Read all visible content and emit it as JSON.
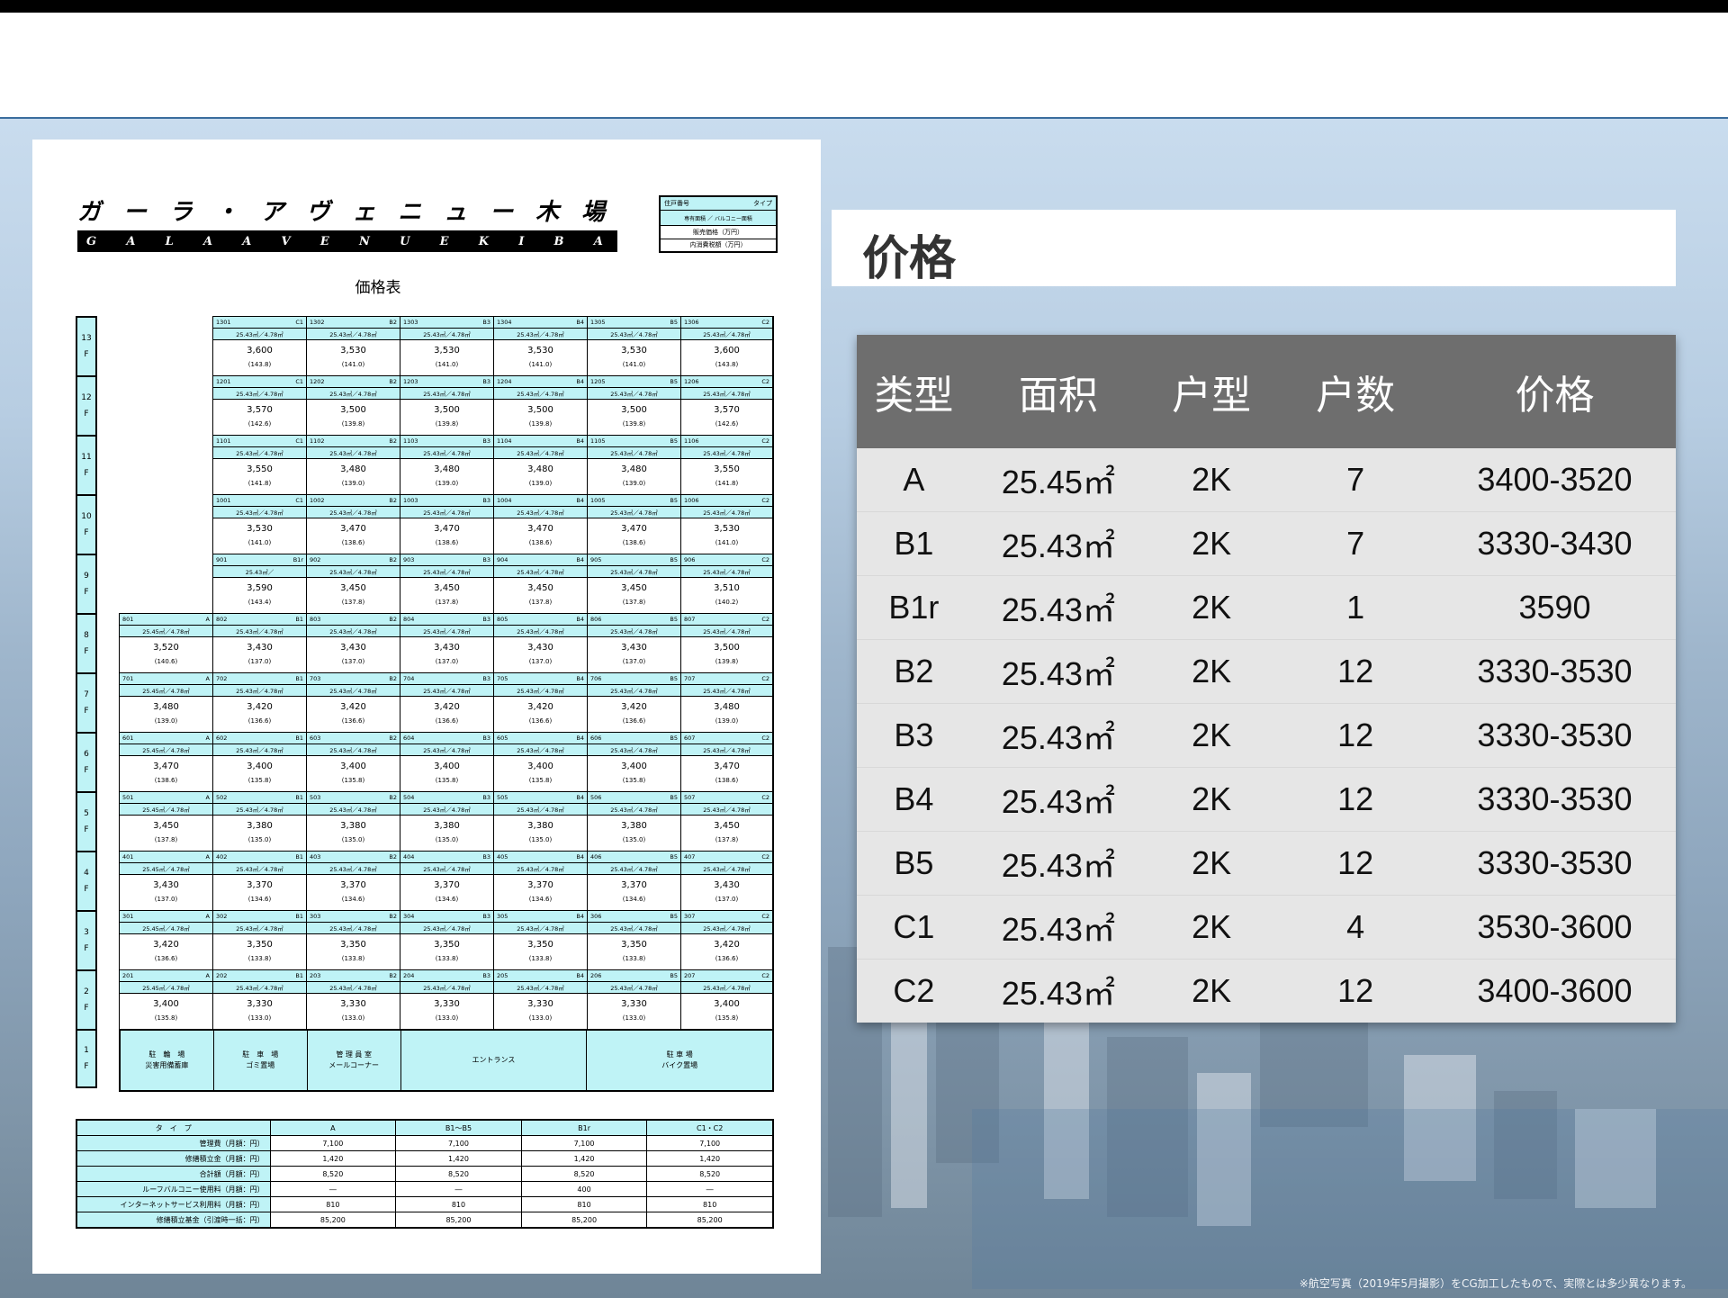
{
  "document": {
    "brand_jp": [
      "ガ",
      "ー",
      "ラ",
      "・",
      "ア",
      "ヴ",
      "ェ",
      "ニ",
      "ュ",
      "ー",
      "木",
      "場"
    ],
    "brand_en": [
      "G",
      "A",
      "L",
      "A",
      "A",
      "V",
      "E",
      "N",
      "U",
      "E",
      "K",
      "I",
      "B",
      "A"
    ],
    "legend": {
      "l1a": "住戸番号",
      "l1b": "タイプ",
      "l2": "専有面積 ／ バルコニー面積",
      "l3": "販売価格（万円）",
      "l4": "内消費税額（万円）"
    },
    "title": "価格表",
    "floors": [
      "13\nF",
      "12\nF",
      "11\nF",
      "10\nF",
      "9\nF",
      "8\nF",
      "7\nF",
      "6\nF",
      "5\nF",
      "4\nF",
      "3\nF",
      "2\nF",
      "1\nF"
    ],
    "rows": [
      {
        "units": [
          null,
          {
            "no": "1301",
            "type": "C1",
            "area": "25.43㎡／4.78㎡",
            "price": "3,600",
            "tax": "(143.8)"
          },
          {
            "no": "1302",
            "type": "B2",
            "area": "25.43㎡／4.78㎡",
            "price": "3,530",
            "tax": "(141.0)"
          },
          {
            "no": "1303",
            "type": "B3",
            "area": "25.43㎡／4.78㎡",
            "price": "3,530",
            "tax": "(141.0)"
          },
          {
            "no": "1304",
            "type": "B4",
            "area": "25.43㎡／4.78㎡",
            "price": "3,530",
            "tax": "(141.0)"
          },
          {
            "no": "1305",
            "type": "B5",
            "area": "25.43㎡／4.78㎡",
            "price": "3,530",
            "tax": "(141.0)"
          },
          {
            "no": "1306",
            "type": "C2",
            "area": "25.43㎡／4.78㎡",
            "price": "3,600",
            "tax": "(143.8)"
          }
        ]
      },
      {
        "units": [
          null,
          {
            "no": "1201",
            "type": "C1",
            "area": "25.43㎡／4.78㎡",
            "price": "3,570",
            "tax": "(142.6)"
          },
          {
            "no": "1202",
            "type": "B2",
            "area": "25.43㎡／4.78㎡",
            "price": "3,500",
            "tax": "(139.8)"
          },
          {
            "no": "1203",
            "type": "B3",
            "area": "25.43㎡／4.78㎡",
            "price": "3,500",
            "tax": "(139.8)"
          },
          {
            "no": "1204",
            "type": "B4",
            "area": "25.43㎡／4.78㎡",
            "price": "3,500",
            "tax": "(139.8)"
          },
          {
            "no": "1205",
            "type": "B5",
            "area": "25.43㎡／4.78㎡",
            "price": "3,500",
            "tax": "(139.8)"
          },
          {
            "no": "1206",
            "type": "C2",
            "area": "25.43㎡／4.78㎡",
            "price": "3,570",
            "tax": "(142.6)"
          }
        ]
      },
      {
        "units": [
          null,
          {
            "no": "1101",
            "type": "C1",
            "area": "25.43㎡／4.78㎡",
            "price": "3,550",
            "tax": "(141.8)"
          },
          {
            "no": "1102",
            "type": "B2",
            "area": "25.43㎡／4.78㎡",
            "price": "3,480",
            "tax": "(139.0)"
          },
          {
            "no": "1103",
            "type": "B3",
            "area": "25.43㎡／4.78㎡",
            "price": "3,480",
            "tax": "(139.0)"
          },
          {
            "no": "1104",
            "type": "B4",
            "area": "25.43㎡／4.78㎡",
            "price": "3,480",
            "tax": "(139.0)"
          },
          {
            "no": "1105",
            "type": "B5",
            "area": "25.43㎡／4.78㎡",
            "price": "3,480",
            "tax": "(139.0)"
          },
          {
            "no": "1106",
            "type": "C2",
            "area": "25.43㎡／4.78㎡",
            "price": "3,550",
            "tax": "(141.8)"
          }
        ]
      },
      {
        "units": [
          null,
          {
            "no": "1001",
            "type": "C1",
            "area": "25.43㎡／4.78㎡",
            "price": "3,530",
            "tax": "(141.0)"
          },
          {
            "no": "1002",
            "type": "B2",
            "area": "25.43㎡／4.78㎡",
            "price": "3,470",
            "tax": "(138.6)"
          },
          {
            "no": "1003",
            "type": "B3",
            "area": "25.43㎡／4.78㎡",
            "price": "3,470",
            "tax": "(138.6)"
          },
          {
            "no": "1004",
            "type": "B4",
            "area": "25.43㎡／4.78㎡",
            "price": "3,470",
            "tax": "(138.6)"
          },
          {
            "no": "1005",
            "type": "B5",
            "area": "25.43㎡／4.78㎡",
            "price": "3,470",
            "tax": "(138.6)"
          },
          {
            "no": "1006",
            "type": "C2",
            "area": "25.43㎡／4.78㎡",
            "price": "3,530",
            "tax": "(141.0)"
          }
        ]
      },
      {
        "units": [
          null,
          {
            "no": "901",
            "type": "B1r",
            "area": "25.43㎡／",
            "price": "3,590",
            "tax": "(143.4)"
          },
          {
            "no": "902",
            "type": "B2",
            "area": "25.43㎡／4.78㎡",
            "price": "3,450",
            "tax": "(137.8)"
          },
          {
            "no": "903",
            "type": "B3",
            "area": "25.43㎡／4.78㎡",
            "price": "3,450",
            "tax": "(137.8)"
          },
          {
            "no": "904",
            "type": "B4",
            "area": "25.43㎡／4.78㎡",
            "price": "3,450",
            "tax": "(137.8)"
          },
          {
            "no": "905",
            "type": "B5",
            "area": "25.43㎡／4.78㎡",
            "price": "3,450",
            "tax": "(137.8)"
          },
          {
            "no": "906",
            "type": "C2",
            "area": "25.43㎡／4.78㎡",
            "price": "3,510",
            "tax": "(140.2)"
          }
        ]
      },
      {
        "units": [
          {
            "no": "801",
            "type": "A",
            "area": "25.45㎡／4.78㎡",
            "price": "3,520",
            "tax": "(140.6)"
          },
          {
            "no": "802",
            "type": "B1",
            "area": "25.43㎡／4.78㎡",
            "price": "3,430",
            "tax": "(137.0)"
          },
          {
            "no": "803",
            "type": "B2",
            "area": "25.43㎡／4.78㎡",
            "price": "3,430",
            "tax": "(137.0)"
          },
          {
            "no": "804",
            "type": "B3",
            "area": "25.43㎡／4.78㎡",
            "price": "3,430",
            "tax": "(137.0)"
          },
          {
            "no": "805",
            "type": "B4",
            "area": "25.43㎡／4.78㎡",
            "price": "3,430",
            "tax": "(137.0)"
          },
          {
            "no": "806",
            "type": "B5",
            "area": "25.43㎡／4.78㎡",
            "price": "3,430",
            "tax": "(137.0)"
          },
          {
            "no": "807",
            "type": "C2",
            "area": "25.43㎡／4.78㎡",
            "price": "3,500",
            "tax": "(139.8)"
          }
        ]
      },
      {
        "units": [
          {
            "no": "701",
            "type": "A",
            "area": "25.45㎡／4.78㎡",
            "price": "3,480",
            "tax": "(139.0)"
          },
          {
            "no": "702",
            "type": "B1",
            "area": "25.43㎡／4.78㎡",
            "price": "3,420",
            "tax": "(136.6)"
          },
          {
            "no": "703",
            "type": "B2",
            "area": "25.43㎡／4.78㎡",
            "price": "3,420",
            "tax": "(136.6)"
          },
          {
            "no": "704",
            "type": "B3",
            "area": "25.43㎡／4.78㎡",
            "price": "3,420",
            "tax": "(136.6)"
          },
          {
            "no": "705",
            "type": "B4",
            "area": "25.43㎡／4.78㎡",
            "price": "3,420",
            "tax": "(136.6)"
          },
          {
            "no": "706",
            "type": "B5",
            "area": "25.43㎡／4.78㎡",
            "price": "3,420",
            "tax": "(136.6)"
          },
          {
            "no": "707",
            "type": "C2",
            "area": "25.43㎡／4.78㎡",
            "price": "3,480",
            "tax": "(139.0)"
          }
        ]
      },
      {
        "units": [
          {
            "no": "601",
            "type": "A",
            "area": "25.45㎡／4.78㎡",
            "price": "3,470",
            "tax": "(138.6)"
          },
          {
            "no": "602",
            "type": "B1",
            "area": "25.43㎡／4.78㎡",
            "price": "3,400",
            "tax": "(135.8)"
          },
          {
            "no": "603",
            "type": "B2",
            "area": "25.43㎡／4.78㎡",
            "price": "3,400",
            "tax": "(135.8)"
          },
          {
            "no": "604",
            "type": "B3",
            "area": "25.43㎡／4.78㎡",
            "price": "3,400",
            "tax": "(135.8)"
          },
          {
            "no": "605",
            "type": "B4",
            "area": "25.43㎡／4.78㎡",
            "price": "3,400",
            "tax": "(135.8)"
          },
          {
            "no": "606",
            "type": "B5",
            "area": "25.43㎡／4.78㎡",
            "price": "3,400",
            "tax": "(135.8)"
          },
          {
            "no": "607",
            "type": "C2",
            "area": "25.43㎡／4.78㎡",
            "price": "3,470",
            "tax": "(138.6)"
          }
        ]
      },
      {
        "units": [
          {
            "no": "501",
            "type": "A",
            "area": "25.45㎡／4.78㎡",
            "price": "3,450",
            "tax": "(137.8)"
          },
          {
            "no": "502",
            "type": "B1",
            "area": "25.43㎡／4.78㎡",
            "price": "3,380",
            "tax": "(135.0)"
          },
          {
            "no": "503",
            "type": "B2",
            "area": "25.43㎡／4.78㎡",
            "price": "3,380",
            "tax": "(135.0)"
          },
          {
            "no": "504",
            "type": "B3",
            "area": "25.43㎡／4.78㎡",
            "price": "3,380",
            "tax": "(135.0)"
          },
          {
            "no": "505",
            "type": "B4",
            "area": "25.43㎡／4.78㎡",
            "price": "3,380",
            "tax": "(135.0)"
          },
          {
            "no": "506",
            "type": "B5",
            "area": "25.43㎡／4.78㎡",
            "price": "3,380",
            "tax": "(135.0)"
          },
          {
            "no": "507",
            "type": "C2",
            "area": "25.43㎡／4.78㎡",
            "price": "3,450",
            "tax": "(137.8)"
          }
        ]
      },
      {
        "units": [
          {
            "no": "401",
            "type": "A",
            "area": "25.45㎡／4.78㎡",
            "price": "3,430",
            "tax": "(137.0)"
          },
          {
            "no": "402",
            "type": "B1",
            "area": "25.43㎡／4.78㎡",
            "price": "3,370",
            "tax": "(134.6)"
          },
          {
            "no": "403",
            "type": "B2",
            "area": "25.43㎡／4.78㎡",
            "price": "3,370",
            "tax": "(134.6)"
          },
          {
            "no": "404",
            "type": "B3",
            "area": "25.43㎡／4.78㎡",
            "price": "3,370",
            "tax": "(134.6)"
          },
          {
            "no": "405",
            "type": "B4",
            "area": "25.43㎡／4.78㎡",
            "price": "3,370",
            "tax": "(134.6)"
          },
          {
            "no": "406",
            "type": "B5",
            "area": "25.43㎡／4.78㎡",
            "price": "3,370",
            "tax": "(134.6)"
          },
          {
            "no": "407",
            "type": "C2",
            "area": "25.43㎡／4.78㎡",
            "price": "3,430",
            "tax": "(137.0)"
          }
        ]
      },
      {
        "units": [
          {
            "no": "301",
            "type": "A",
            "area": "25.45㎡／4.78㎡",
            "price": "3,420",
            "tax": "(136.6)"
          },
          {
            "no": "302",
            "type": "B1",
            "area": "25.43㎡／4.78㎡",
            "price": "3,350",
            "tax": "(133.8)"
          },
          {
            "no": "303",
            "type": "B2",
            "area": "25.43㎡／4.78㎡",
            "price": "3,350",
            "tax": "(133.8)"
          },
          {
            "no": "304",
            "type": "B3",
            "area": "25.43㎡／4.78㎡",
            "price": "3,350",
            "tax": "(133.8)"
          },
          {
            "no": "305",
            "type": "B4",
            "area": "25.43㎡／4.78㎡",
            "price": "3,350",
            "tax": "(133.8)"
          },
          {
            "no": "306",
            "type": "B5",
            "area": "25.43㎡／4.78㎡",
            "price": "3,350",
            "tax": "(133.8)"
          },
          {
            "no": "307",
            "type": "C2",
            "area": "25.43㎡／4.78㎡",
            "price": "3,420",
            "tax": "(136.6)"
          }
        ]
      },
      {
        "units": [
          {
            "no": "201",
            "type": "A",
            "area": "25.45㎡／4.78㎡",
            "price": "3,400",
            "tax": "(135.8)"
          },
          {
            "no": "202",
            "type": "B1",
            "area": "25.43㎡／4.78㎡",
            "price": "3,330",
            "tax": "(133.0)"
          },
          {
            "no": "203",
            "type": "B2",
            "area": "25.43㎡／4.78㎡",
            "price": "3,330",
            "tax": "(133.0)"
          },
          {
            "no": "204",
            "type": "B3",
            "area": "25.43㎡／4.78㎡",
            "price": "3,330",
            "tax": "(133.0)"
          },
          {
            "no": "205",
            "type": "B4",
            "area": "25.43㎡／4.78㎡",
            "price": "3,330",
            "tax": "(133.0)"
          },
          {
            "no": "206",
            "type": "B5",
            "area": "25.43㎡／4.78㎡",
            "price": "3,330",
            "tax": "(133.0)"
          },
          {
            "no": "207",
            "type": "C2",
            "area": "25.43㎡／4.78㎡",
            "price": "3,400",
            "tax": "(135.8)"
          }
        ]
      }
    ],
    "ground": [
      "駐　輪　場\n災害用備蓄庫",
      "駐　車　場\nゴミ置場",
      "管 理 員 室\nメールコーナー",
      "エントランス",
      "駐 車 場\nバイク置場"
    ],
    "fees": {
      "header": [
        "タ　イ　プ",
        "A",
        "B1～B5",
        "B1r",
        "C1・C2"
      ],
      "rows": [
        [
          "管理費（月額：円）",
          "7,100",
          "7,100",
          "7,100",
          "7,100"
        ],
        [
          "修繕積立金（月額：円）",
          "1,420",
          "1,420",
          "1,420",
          "1,420"
        ],
        [
          "合計額（月額：円）",
          "8,520",
          "8,520",
          "8,520",
          "8,520"
        ],
        [
          "ルーフバルコニー使用料（月額：円）",
          "―",
          "―",
          "400",
          "―"
        ],
        [
          "インターネットサービス利用料（月額：円）",
          "810",
          "810",
          "810",
          "810"
        ],
        [
          "修繕積立基金（引渡時一括：円）",
          "85,200",
          "85,200",
          "85,200",
          "85,200"
        ]
      ]
    }
  },
  "panel": {
    "title": "价格",
    "headers": [
      "类型",
      "面积",
      "户型",
      "户数",
      "价格"
    ],
    "rows": [
      [
        "A",
        "25.45㎡",
        "2K",
        "7",
        "3400-3520"
      ],
      [
        "B1",
        "25.43㎡",
        "2K",
        "7",
        "3330-3430"
      ],
      [
        "B1r",
        "25.43㎡",
        "2K",
        "1",
        "3590"
      ],
      [
        "B2",
        "25.43㎡",
        "2K",
        "12",
        "3330-3530"
      ],
      [
        "B3",
        "25.43㎡",
        "2K",
        "12",
        "3330-3530"
      ],
      [
        "B4",
        "25.43㎡",
        "2K",
        "12",
        "3330-3530"
      ],
      [
        "B5",
        "25.43㎡",
        "2K",
        "12",
        "3330-3530"
      ],
      [
        "C1",
        "25.43㎡",
        "2K",
        "4",
        "3530-3600"
      ],
      [
        "C2",
        "25.43㎡",
        "2K",
        "12",
        "3400-3600"
      ]
    ]
  },
  "caption": "※航空写真（2019年5月撮影）をCG加工したもので、実際とは多少異なります。"
}
